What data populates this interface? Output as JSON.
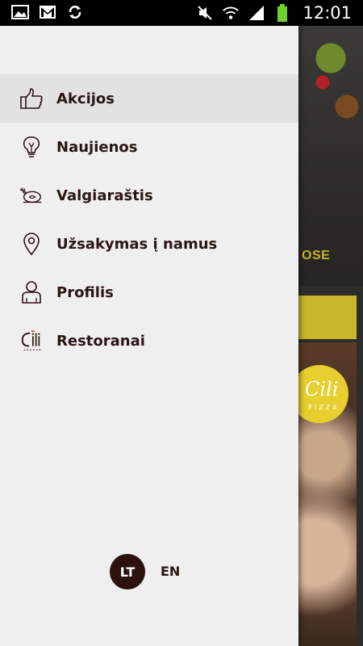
{
  "status_bar": {
    "time": "12:01",
    "left_icons": [
      "image-icon",
      "gmail-icon",
      "sync-icon"
    ],
    "right_icons": [
      "mute-icon",
      "wifi-icon",
      "signal-icon",
      "battery-icon"
    ]
  },
  "background": {
    "partial_text": "OSE",
    "logo_text": "Cili",
    "logo_subtext": "PIZZA",
    "accent_color": "#c9b52a"
  },
  "menu": {
    "items": [
      {
        "label": "Akcijos",
        "icon": "thumbs-up-icon",
        "active": true
      },
      {
        "label": "Naujienos",
        "icon": "lightbulb-icon",
        "active": false
      },
      {
        "label": "Valgiaraštis",
        "icon": "roast-chicken-icon",
        "active": false
      },
      {
        "label": "Užsakymas į namus",
        "icon": "location-pin-icon",
        "active": false
      },
      {
        "label": "Profilis",
        "icon": "user-icon",
        "active": false
      },
      {
        "label": "Restoranai",
        "icon": "cili-pizza-logo-icon",
        "active": false
      }
    ]
  },
  "language": {
    "selected": "LT",
    "other": "EN"
  },
  "colors": {
    "drawer_bg": "#efefef",
    "active_bg": "#e2e2e2",
    "text": "#2b1614",
    "lang_badge": "#2c1110"
  }
}
